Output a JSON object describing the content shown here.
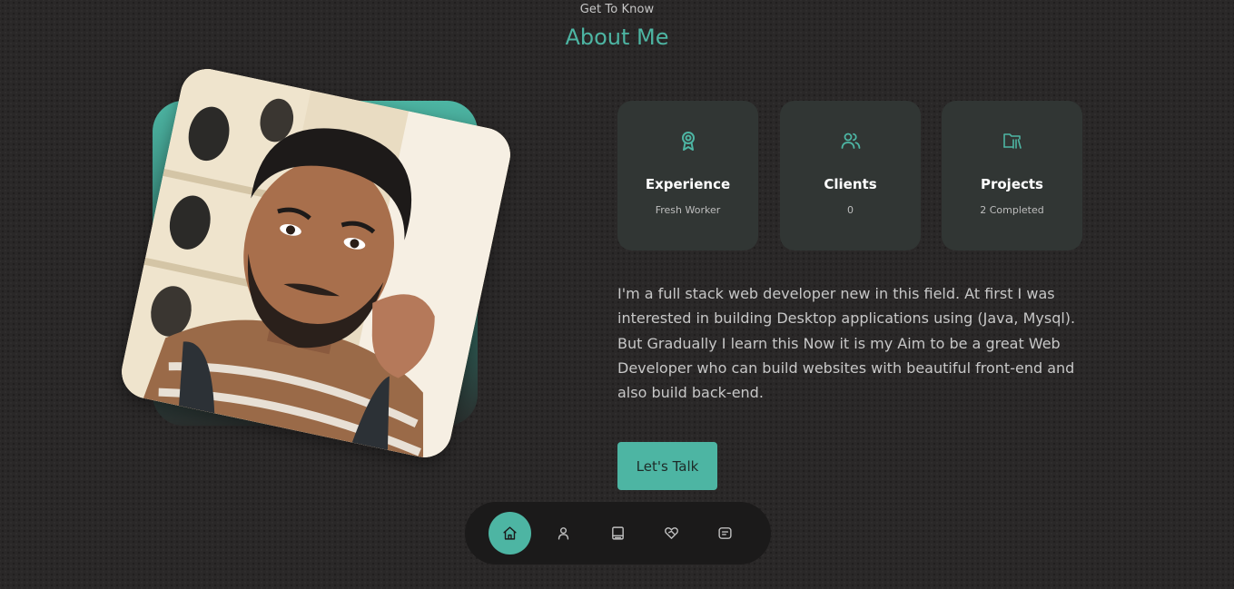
{
  "header": {
    "subtitle": "Get To Know",
    "title": "About Me"
  },
  "stats": [
    {
      "icon": "award-icon",
      "title": "Experience",
      "value": "Fresh Worker"
    },
    {
      "icon": "users-icon",
      "title": "Clients",
      "value": "0"
    },
    {
      "icon": "folder-library-icon",
      "title": "Projects",
      "value": "2 Completed"
    }
  ],
  "about_text": "I'm a full stack web developer new in this field. At first I was interested in building Desktop applications using (Java, Mysql). But Gradually I learn this Now it is my Aim to be a great Web Developer who can build websites with beautiful front-end and also build back-end.",
  "cta_label": "Let's Talk",
  "nav": {
    "items": [
      {
        "icon": "home-icon",
        "active": true
      },
      {
        "icon": "user-icon",
        "active": false
      },
      {
        "icon": "book-icon",
        "active": false
      },
      {
        "icon": "service-icon",
        "active": false
      },
      {
        "icon": "message-icon",
        "active": false
      }
    ]
  },
  "colors": {
    "accent": "#4db5a3",
    "background": "#2a2828",
    "card": "#313634",
    "nav": "#1b1a1a"
  }
}
